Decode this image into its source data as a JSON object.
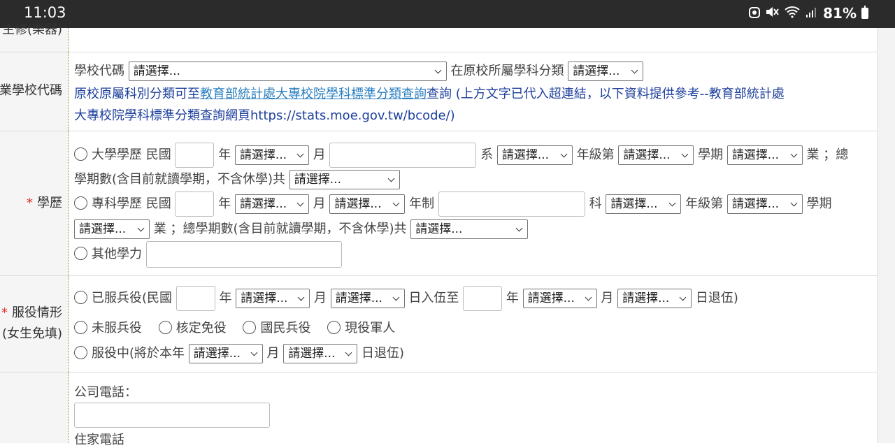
{
  "status_bar": {
    "time": "11:03",
    "battery": "81%"
  },
  "rows": {
    "major": {
      "label": "主修(樂器)"
    },
    "school_code": {
      "label": "業學校代碼",
      "school_code_text": "學校代碼",
      "school_code_select": "請選擇...",
      "dept_class_text": "在原校所屬學科分類",
      "dept_class_select": "請選擇...",
      "note_prefix": "原校原屬科別分類可至",
      "note_link": "教育部統計處大專校院學科標準分類查詢",
      "note_line1_suffix": "查詢 (上方文字已代入超連結，以下資料提供參考--教育部統計處",
      "note_line2": "大專校院學科標準分類查詢網頁https://stats.moe.gov.tw/bcode/)"
    },
    "education": {
      "label": "學歷",
      "uni": {
        "label": "大學學歷 民國",
        "year_unit": "年",
        "month_select": "請選擇...",
        "month_unit": "月",
        "dept_unit": "系",
        "grade_select": "請選擇...",
        "grade_unit": "年級第",
        "semester_select": "請選擇...",
        "semester_unit": "學期",
        "status_select": "請選擇...",
        "status_unit": "業 ；總",
        "total_text": "學期數(含目前就讀學期，不含休學)共",
        "total_select": "請選擇..."
      },
      "college": {
        "label": "專科學歷 民國",
        "year_unit": "年",
        "month_select": "請選擇...",
        "month_unit": "月",
        "system_select": "請選擇...",
        "system_unit": "年制",
        "dept_unit": "科",
        "grade_select": "請選擇...",
        "grade_unit": "年級第",
        "semester_select": "請選擇...",
        "semester_unit": "學期",
        "status_select": "請選擇...",
        "status_unit": "業 ；總學期數(含目前就讀學期，不含休學)共",
        "total_select": "請選擇..."
      },
      "other": {
        "label": "其他學力"
      }
    },
    "military": {
      "label_line1": "服役情形",
      "label_line2": "(女生免填)",
      "served": {
        "label": "已服兵役(民國",
        "year_unit": "年",
        "month_select": "請選擇...",
        "month_unit": "月",
        "day_select": "請選擇...",
        "day_unit": "日入伍至",
        "end_year_unit": "年",
        "end_month_select": "請選擇...",
        "end_month_unit": "月",
        "end_day_select": "請選擇...",
        "end_day_unit": "日退伍)"
      },
      "options": [
        "未服兵役",
        "核定免役",
        "國民兵役",
        "現役軍人"
      ],
      "serving": {
        "label": "服役中(將於本年",
        "month_select": "請選擇...",
        "month_unit": "月",
        "day_select": "請選擇...",
        "day_unit": "日退伍)"
      }
    },
    "contact": {
      "company_phone": "公司電話：",
      "home_phone": "住家電話"
    }
  }
}
